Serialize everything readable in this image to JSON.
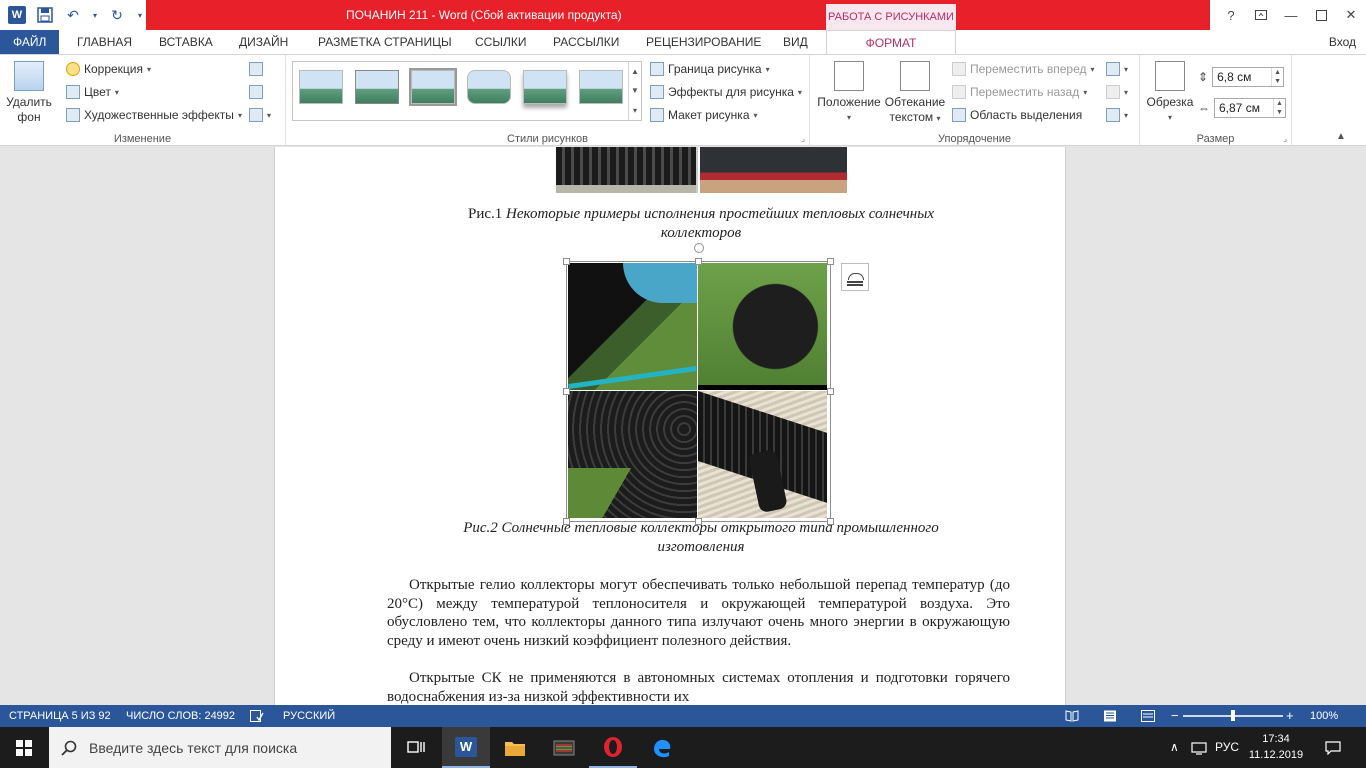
{
  "titlebar": {
    "title": "ПОЧАНИН 211 -  Word (Сбой активации продукта)",
    "context_tab_header": "РАБОТА С РИСУНКАМИ",
    "help": "?"
  },
  "tabs": {
    "file": "ФАЙЛ",
    "items": [
      "ГЛАВНАЯ",
      "ВСТАВКА",
      "ДИЗАЙН",
      "РАЗМЕТКА СТРАНИЦЫ",
      "ССЫЛКИ",
      "РАССЫЛКИ",
      "РЕЦЕНЗИРОВАНИЕ",
      "ВИД"
    ],
    "format": "ФОРМАТ",
    "login": "Вход"
  },
  "ribbon": {
    "adjust": {
      "remove_bg_line1": "Удалить",
      "remove_bg_line2": "фон",
      "correction": "Коррекция",
      "color": "Цвет",
      "artistic": "Художественные эффекты",
      "label": "Изменение"
    },
    "styles": {
      "border": "Граница рисунка",
      "effects": "Эффекты для рисунка",
      "layout": "Макет рисунка",
      "label": "Стили рисунков"
    },
    "arrange": {
      "position_line1": "Положение",
      "wrap_line1": "Обтекание",
      "wrap_line2": "текстом",
      "bring_forward": "Переместить вперед",
      "send_backward": "Переместить назад",
      "selection_pane": "Область выделения",
      "label": "Упорядочение"
    },
    "size": {
      "crop": "Обрезка",
      "height": "6,8 см",
      "width": "6,87 см",
      "label": "Размер"
    }
  },
  "document": {
    "caption1_prefix": "Рис.1 ",
    "caption1_line1": "Некоторые примеры исполнения простейших тепловых солнечных",
    "caption1_line2": "коллекторов",
    "caption2_line1": "Рис.2 Солнечные тепловые коллекторы открытого типа промышленного",
    "caption2_line2": "изготовления",
    "para1": "Открытые гелио коллекторы могут обеспечивать только небольшой перепад температур (до 20°С) между температурой теплоносителя и окружающей температурой воздуха. Это обусловлено тем, что коллекторы данного типа излучают очень много энергии в окружающую среду и имеют очень низкий коэффициент полезного действия.",
    "para2": "Открытые СК не применяются в автономных системах отопления и подготовки горячего водоснабжения из-за низкой эффективности их"
  },
  "statusbar": {
    "page": "СТРАНИЦА 5 ИЗ 92",
    "words": "ЧИСЛО СЛОВ: 24992",
    "language": "РУССКИЙ",
    "zoom": "100%",
    "zoom_level": 0.5
  },
  "taskbar": {
    "search_placeholder": "Введите здесь текст для поиска",
    "lang": "РУС",
    "time": "17:34",
    "date": "11.12.2019"
  },
  "colors": {
    "accent": "#2b579a",
    "title_red": "#e8202a",
    "context_pink": "#b52e6b"
  }
}
